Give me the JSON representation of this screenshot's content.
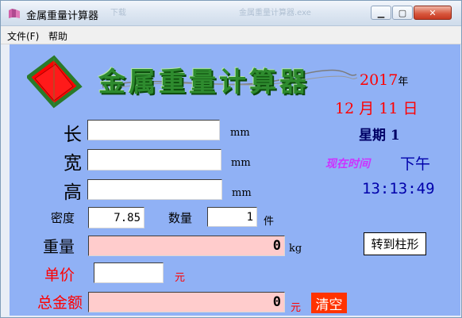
{
  "window": {
    "title": "金属重量计算器",
    "ghost_tab_1": "下载",
    "ghost_tab_2": "金属重量计算器.exe"
  },
  "menu": {
    "file": "文件(F)",
    "help": "帮助"
  },
  "banner": {
    "text": "金属重量计算器"
  },
  "fields": {
    "length": {
      "label": "长",
      "value": "",
      "unit": "mm"
    },
    "width": {
      "label": "宽",
      "value": "",
      "unit": "mm"
    },
    "height": {
      "label": "高",
      "value": "",
      "unit": "mm"
    },
    "density": {
      "label": "密度",
      "value": "7.85"
    },
    "quantity": {
      "label": "数量",
      "value": "1",
      "unit": "件"
    },
    "weight": {
      "label": "重量",
      "value": "0",
      "unit": "kg"
    },
    "unit_price": {
      "label": "单价",
      "value": "",
      "unit": "元"
    },
    "total": {
      "label": "总金额",
      "value": "0",
      "unit": "元"
    }
  },
  "buttons": {
    "chart": "转到柱形",
    "clear": "清空"
  },
  "clock": {
    "year": "2017",
    "year_unit": "年",
    "month": "12",
    "month_unit": "月",
    "day": "11",
    "day_unit": "日",
    "weekday_label": "星期",
    "weekday": "1",
    "now_label": "现在时间",
    "ampm": "下午",
    "time": "13:13:49"
  },
  "colors": {
    "client_bg": "#90b1f5",
    "result_bg": "#ffcccc",
    "clear_bg": "#ff3300",
    "accent_red": "#ff0000"
  }
}
